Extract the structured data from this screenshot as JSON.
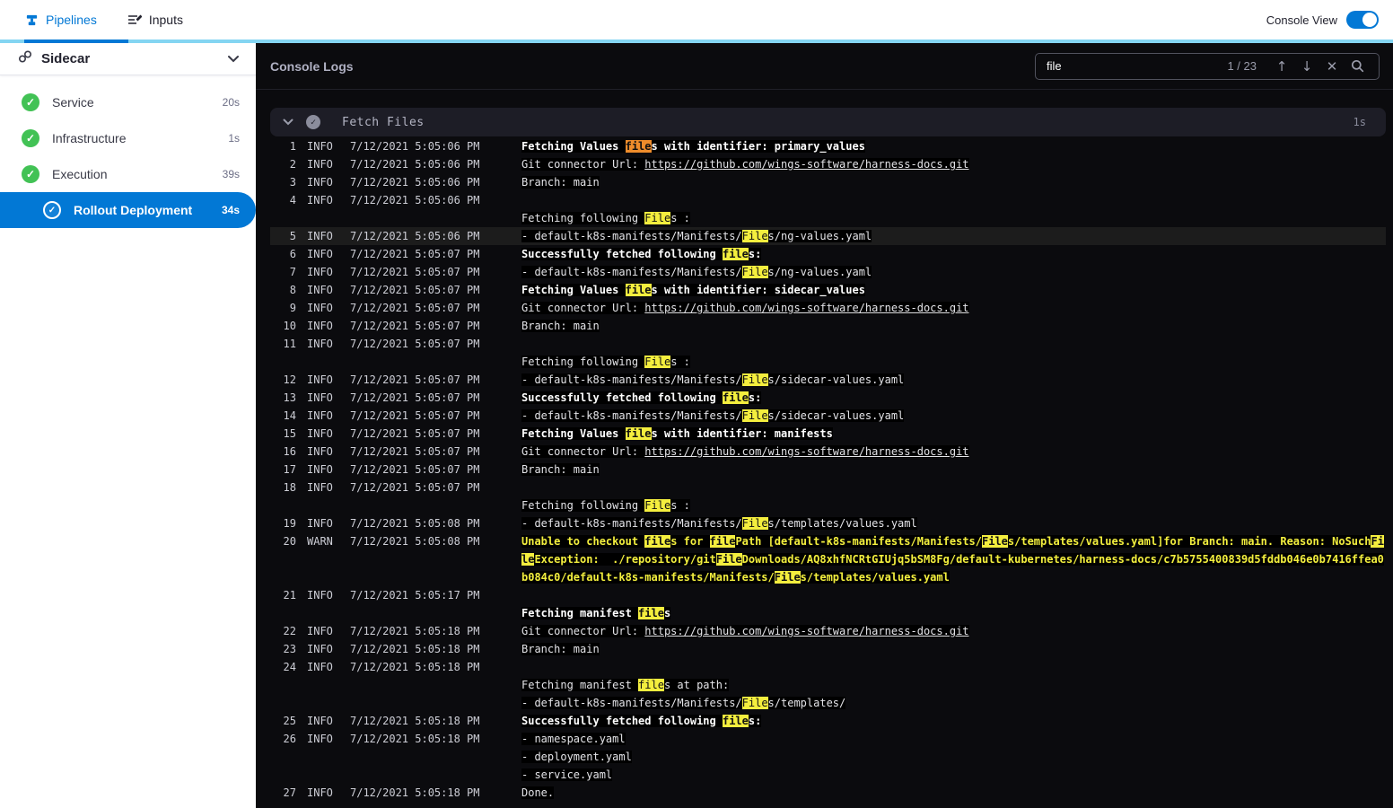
{
  "colors": {
    "accent": "#0278d5",
    "accent_light": "#84d5f2",
    "success_green": "#42c255",
    "console_bg": "#0b0b0e",
    "panel_bg": "#1d1d26",
    "highlight_yellow": "#f4ee3e",
    "highlight_current": "#ee8c2b",
    "warn_text": "#f3ef3e"
  },
  "icons": {
    "check": "✓",
    "arrow_up": "↑",
    "arrow_down": "↓",
    "close": "✕"
  },
  "top_bar": {
    "tabs": [
      {
        "label": "Pipelines"
      },
      {
        "label": "Inputs"
      }
    ],
    "console_view_label": "Console View",
    "console_view_on": true
  },
  "sidebar": {
    "title": "Sidecar",
    "items": [
      {
        "label": "Service",
        "duration": "20s",
        "status": "success"
      },
      {
        "label": "Infrastructure",
        "duration": "1s",
        "status": "success"
      },
      {
        "label": "Execution",
        "duration": "39s",
        "status": "success"
      },
      {
        "label": "Rollout Deployment",
        "duration": "34s",
        "status": "success",
        "selected": true
      }
    ]
  },
  "console": {
    "title": "Console Logs",
    "search": {
      "value": "file",
      "counter": "1 / 23"
    },
    "section": {
      "title": "Fetch Files",
      "duration": "1s"
    },
    "search_term": "file",
    "lines": [
      {
        "num": 1,
        "level": "INFO",
        "time": "7/12/2021 5:05:06 PM",
        "rows": [
          {
            "text": "Fetching Values files with identifier: primary_values",
            "bold": true
          }
        ]
      },
      {
        "num": 2,
        "level": "INFO",
        "time": "7/12/2021 5:05:06 PM",
        "rows": [
          {
            "text": "Git connector Url: ",
            "url": "https://github.com/wings-software/harness-docs.git"
          }
        ]
      },
      {
        "num": 3,
        "level": "INFO",
        "time": "7/12/2021 5:05:06 PM",
        "rows": [
          {
            "text": "Branch: main"
          }
        ]
      },
      {
        "num": 4,
        "level": "INFO",
        "time": "7/12/2021 5:05:06 PM",
        "rows": [
          {
            "text": ""
          },
          {
            "text": "Fetching following Files :"
          }
        ]
      },
      {
        "num": 5,
        "level": "INFO",
        "time": "7/12/2021 5:05:06 PM",
        "selected": true,
        "rows": [
          {
            "text": "- default-k8s-manifests/Manifests/Files/ng-values.yaml"
          }
        ]
      },
      {
        "num": 6,
        "level": "INFO",
        "time": "7/12/2021 5:05:07 PM",
        "rows": [
          {
            "text": "Successfully fetched following files:",
            "bold": true
          }
        ]
      },
      {
        "num": 7,
        "level": "INFO",
        "time": "7/12/2021 5:05:07 PM",
        "rows": [
          {
            "text": "- default-k8s-manifests/Manifests/Files/ng-values.yaml"
          }
        ]
      },
      {
        "num": 8,
        "level": "INFO",
        "time": "7/12/2021 5:05:07 PM",
        "rows": [
          {
            "text": "Fetching Values files with identifier: sidecar_values",
            "bold": true
          }
        ]
      },
      {
        "num": 9,
        "level": "INFO",
        "time": "7/12/2021 5:05:07 PM",
        "rows": [
          {
            "text": "Git connector Url: ",
            "url": "https://github.com/wings-software/harness-docs.git"
          }
        ]
      },
      {
        "num": 10,
        "level": "INFO",
        "time": "7/12/2021 5:05:07 PM",
        "rows": [
          {
            "text": "Branch: main"
          }
        ]
      },
      {
        "num": 11,
        "level": "INFO",
        "time": "7/12/2021 5:05:07 PM",
        "rows": [
          {
            "text": ""
          },
          {
            "text": "Fetching following Files :"
          }
        ]
      },
      {
        "num": 12,
        "level": "INFO",
        "time": "7/12/2021 5:05:07 PM",
        "rows": [
          {
            "text": "- default-k8s-manifests/Manifests/Files/sidecar-values.yaml"
          }
        ]
      },
      {
        "num": 13,
        "level": "INFO",
        "time": "7/12/2021 5:05:07 PM",
        "rows": [
          {
            "text": "Successfully fetched following files:",
            "bold": true
          }
        ]
      },
      {
        "num": 14,
        "level": "INFO",
        "time": "7/12/2021 5:05:07 PM",
        "rows": [
          {
            "text": "- default-k8s-manifests/Manifests/Files/sidecar-values.yaml"
          }
        ]
      },
      {
        "num": 15,
        "level": "INFO",
        "time": "7/12/2021 5:05:07 PM",
        "rows": [
          {
            "text": "Fetching Values files with identifier: manifests",
            "bold": true
          }
        ]
      },
      {
        "num": 16,
        "level": "INFO",
        "time": "7/12/2021 5:05:07 PM",
        "rows": [
          {
            "text": "Git connector Url: ",
            "url": "https://github.com/wings-software/harness-docs.git"
          }
        ]
      },
      {
        "num": 17,
        "level": "INFO",
        "time": "7/12/2021 5:05:07 PM",
        "rows": [
          {
            "text": "Branch: main"
          }
        ]
      },
      {
        "num": 18,
        "level": "INFO",
        "time": "7/12/2021 5:05:07 PM",
        "rows": [
          {
            "text": ""
          },
          {
            "text": "Fetching following Files :"
          }
        ]
      },
      {
        "num": 19,
        "level": "INFO",
        "time": "7/12/2021 5:05:08 PM",
        "rows": [
          {
            "text": "- default-k8s-manifests/Manifests/Files/templates/values.yaml"
          }
        ]
      },
      {
        "num": 20,
        "level": "WARN",
        "time": "7/12/2021 5:05:08 PM",
        "rows": [
          {
            "text": "Unable to checkout files for filePath [default-k8s-manifests/Manifests/Files/templates/values.yaml]for Branch: main. Reason: NoSuchFileException:  ./repository/gitFileDownloads/AQ8xhfNCRtGIUjq5bSM8Fg/default-kubernetes/harness-docs/c7b5755400839d5fddb046e0b7416ffea0b084c0/default-k8s-manifests/Manifests/Files/templates/values.yaml",
            "bold": true
          }
        ]
      },
      {
        "num": 21,
        "level": "INFO",
        "time": "7/12/2021 5:05:17 PM",
        "rows": [
          {
            "text": ""
          },
          {
            "text": "Fetching manifest files",
            "bold": true
          }
        ]
      },
      {
        "num": 22,
        "level": "INFO",
        "time": "7/12/2021 5:05:18 PM",
        "rows": [
          {
            "text": "Git connector Url: ",
            "url": "https://github.com/wings-software/harness-docs.git"
          }
        ]
      },
      {
        "num": 23,
        "level": "INFO",
        "time": "7/12/2021 5:05:18 PM",
        "rows": [
          {
            "text": "Branch: main"
          }
        ]
      },
      {
        "num": 24,
        "level": "INFO",
        "time": "7/12/2021 5:05:18 PM",
        "rows": [
          {
            "text": ""
          },
          {
            "text": "Fetching manifest files at path:"
          },
          {
            "text": "- default-k8s-manifests/Manifests/Files/templates/"
          }
        ]
      },
      {
        "num": 25,
        "level": "INFO",
        "time": "7/12/2021 5:05:18 PM",
        "rows": [
          {
            "text": "Successfully fetched following files:",
            "bold": true
          }
        ]
      },
      {
        "num": 26,
        "level": "INFO",
        "time": "7/12/2021 5:05:18 PM",
        "rows": [
          {
            "text": "- namespace.yaml"
          },
          {
            "text": "- deployment.yaml"
          },
          {
            "text": "- service.yaml"
          }
        ]
      },
      {
        "num": 27,
        "level": "INFO",
        "time": "7/12/2021 5:05:18 PM",
        "rows": [
          {
            "text": "Done."
          }
        ]
      }
    ]
  }
}
